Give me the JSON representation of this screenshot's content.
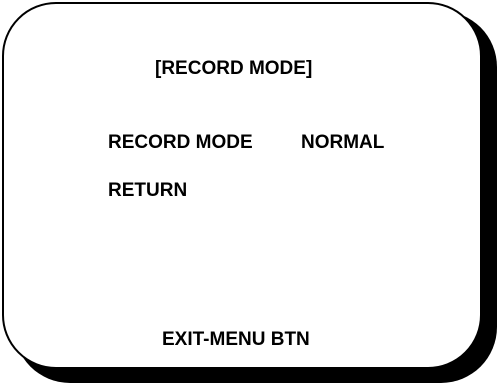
{
  "menu": {
    "title": "[RECORD MODE]",
    "items": [
      {
        "label": "RECORD MODE",
        "value": "NORMAL"
      },
      {
        "label": "RETURN"
      }
    ],
    "footer": "EXIT-MENU BTN"
  }
}
